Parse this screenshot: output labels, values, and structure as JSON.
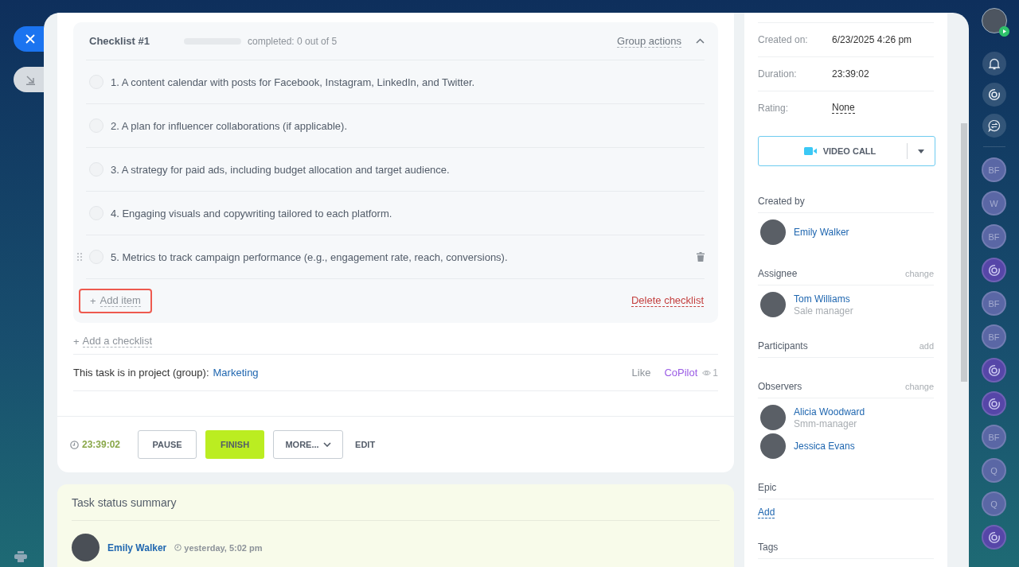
{
  "checklist": {
    "title": "Checklist #1",
    "level": 0,
    "progress_text": "completed: 0 out of 5",
    "group_actions": "Group actions",
    "expanded": true,
    "items": [
      {
        "text": "1. A content calendar with posts for Facebook, Instagram, LinkedIn, and Twitter.",
        "checked": false,
        "hovered": false
      },
      {
        "text": "2. A plan for influencer collaborations (if applicable).",
        "checked": false,
        "hovered": false
      },
      {
        "text": "3. A strategy for paid ads, including budget allocation and target audience.",
        "checked": false,
        "hovered": false
      },
      {
        "text": "4. Engaging visuals and copywriting tailored to each platform.",
        "checked": false,
        "hovered": false
      },
      {
        "text": "5. Metrics to track campaign performance (e.g., engagement rate, reach, conversions).",
        "checked": false,
        "hovered": true
      }
    ],
    "add_item": {
      "prefix": "+",
      "label": "Add item",
      "highlighted": true
    },
    "delete": "Delete checklist"
  },
  "add_checklist": {
    "prefix": "+",
    "label": "Add a checklist"
  },
  "project": {
    "label": "This task is in project (group):",
    "link": "Marketing",
    "like": "Like",
    "copilot": "CoPilot",
    "views": "1"
  },
  "footer": {
    "timer": "23:39:02",
    "buttons": [
      {
        "label": "PAUSE",
        "kind": "outline"
      },
      {
        "label": "FINISH",
        "kind": "primary"
      },
      {
        "label": "MORE...",
        "kind": "dropdown"
      },
      {
        "label": "EDIT",
        "kind": "text"
      }
    ]
  },
  "summary": {
    "title": "Task status summary",
    "author": "Emily Walker",
    "time": "yesterday, 5:02 pm"
  },
  "sidebar": {
    "fields": [
      {
        "label": "Created on:",
        "value": "6/23/2025 4:26 pm",
        "kind": "text"
      },
      {
        "label": "Duration:",
        "value": "23:39:02",
        "kind": "text"
      },
      {
        "label": "Rating:",
        "value": "None",
        "kind": "link"
      }
    ],
    "video_call": "VIDEO CALL",
    "sections": [
      {
        "title": "Created by",
        "people": [
          {
            "name": "Emily Walker"
          }
        ]
      },
      {
        "title": "Assignee",
        "action": "change",
        "people": [
          {
            "name": "Tom Williams",
            "role": "Sale manager"
          }
        ]
      },
      {
        "title": "Participants",
        "action": "add"
      },
      {
        "title": "Observers",
        "action": "change",
        "people": [
          {
            "name": "Alicia Woodward",
            "role": "Smm-manager"
          },
          {
            "name": "Jessica Evans"
          }
        ]
      },
      {
        "title": "Epic",
        "link": "Add"
      },
      {
        "title": "Tags"
      }
    ]
  },
  "rail": {
    "items": [
      {
        "kind": "initials",
        "text": "BF"
      },
      {
        "kind": "initials",
        "text": "W"
      },
      {
        "kind": "initials",
        "text": "BF"
      },
      {
        "kind": "copilot"
      },
      {
        "kind": "initials",
        "text": "BF"
      },
      {
        "kind": "initials",
        "text": "BF"
      },
      {
        "kind": "copilot"
      },
      {
        "kind": "copilot"
      },
      {
        "kind": "initials",
        "text": "BF"
      },
      {
        "kind": "initials",
        "text": "Q"
      },
      {
        "kind": "initials",
        "text": "Q"
      },
      {
        "kind": "copilot"
      }
    ]
  }
}
